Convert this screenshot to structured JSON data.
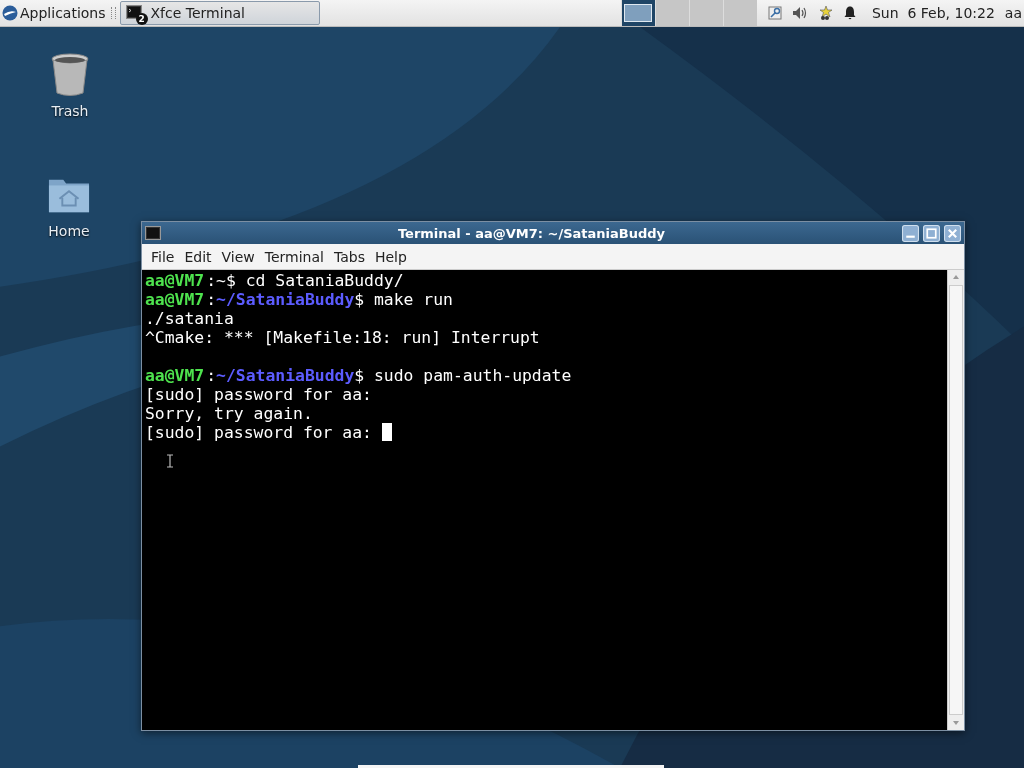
{
  "panel": {
    "applications_label": "Applications",
    "tasks": [
      {
        "label": "Xfce Terminal",
        "badge": "2",
        "selected": true
      }
    ],
    "workspaces": [
      {
        "selected": true
      },
      {
        "selected": false
      },
      {
        "selected": false
      },
      {
        "selected": false
      }
    ],
    "clock": "Sun  6 Feb, 10:22",
    "user": "aa"
  },
  "desktop_icons": [
    {
      "kind": "trash",
      "label": "Trash"
    },
    {
      "kind": "home",
      "label": "Home"
    }
  ],
  "terminal": {
    "title": "Terminal - aa@VM7: ~/SataniaBuddy",
    "menu": [
      "File",
      "Edit",
      "View",
      "Terminal",
      "Tabs",
      "Help"
    ],
    "cursor": true,
    "lines": [
      {
        "segments": [
          {
            "kind": "user",
            "text": "aa@VM7"
          },
          {
            "kind": "plain",
            "text": ":~$ cd SataniaBuddy/"
          }
        ]
      },
      {
        "segments": [
          {
            "kind": "user",
            "text": "aa@VM7"
          },
          {
            "kind": "plain",
            "text": ":"
          },
          {
            "kind": "path",
            "text": "~/SataniaBuddy"
          },
          {
            "kind": "plain",
            "text": "$ make run"
          }
        ]
      },
      {
        "segments": [
          {
            "kind": "plain",
            "text": "./satania"
          }
        ]
      },
      {
        "segments": [
          {
            "kind": "plain",
            "text": "^Cmake: *** [Makefile:18: run] Interrupt"
          }
        ]
      },
      {
        "kind": "blank"
      },
      {
        "segments": [
          {
            "kind": "user",
            "text": "aa@VM7"
          },
          {
            "kind": "plain",
            "text": ":"
          },
          {
            "kind": "path",
            "text": "~/SataniaBuddy"
          },
          {
            "kind": "plain",
            "text": "$ sudo pam-auth-update"
          }
        ]
      },
      {
        "segments": [
          {
            "kind": "plain",
            "text": "[sudo] password for aa:"
          }
        ]
      },
      {
        "segments": [
          {
            "kind": "plain",
            "text": "Sorry, try again."
          }
        ]
      },
      {
        "segments": [
          {
            "kind": "plain",
            "text": "[sudo] password for aa: "
          }
        ]
      }
    ]
  }
}
